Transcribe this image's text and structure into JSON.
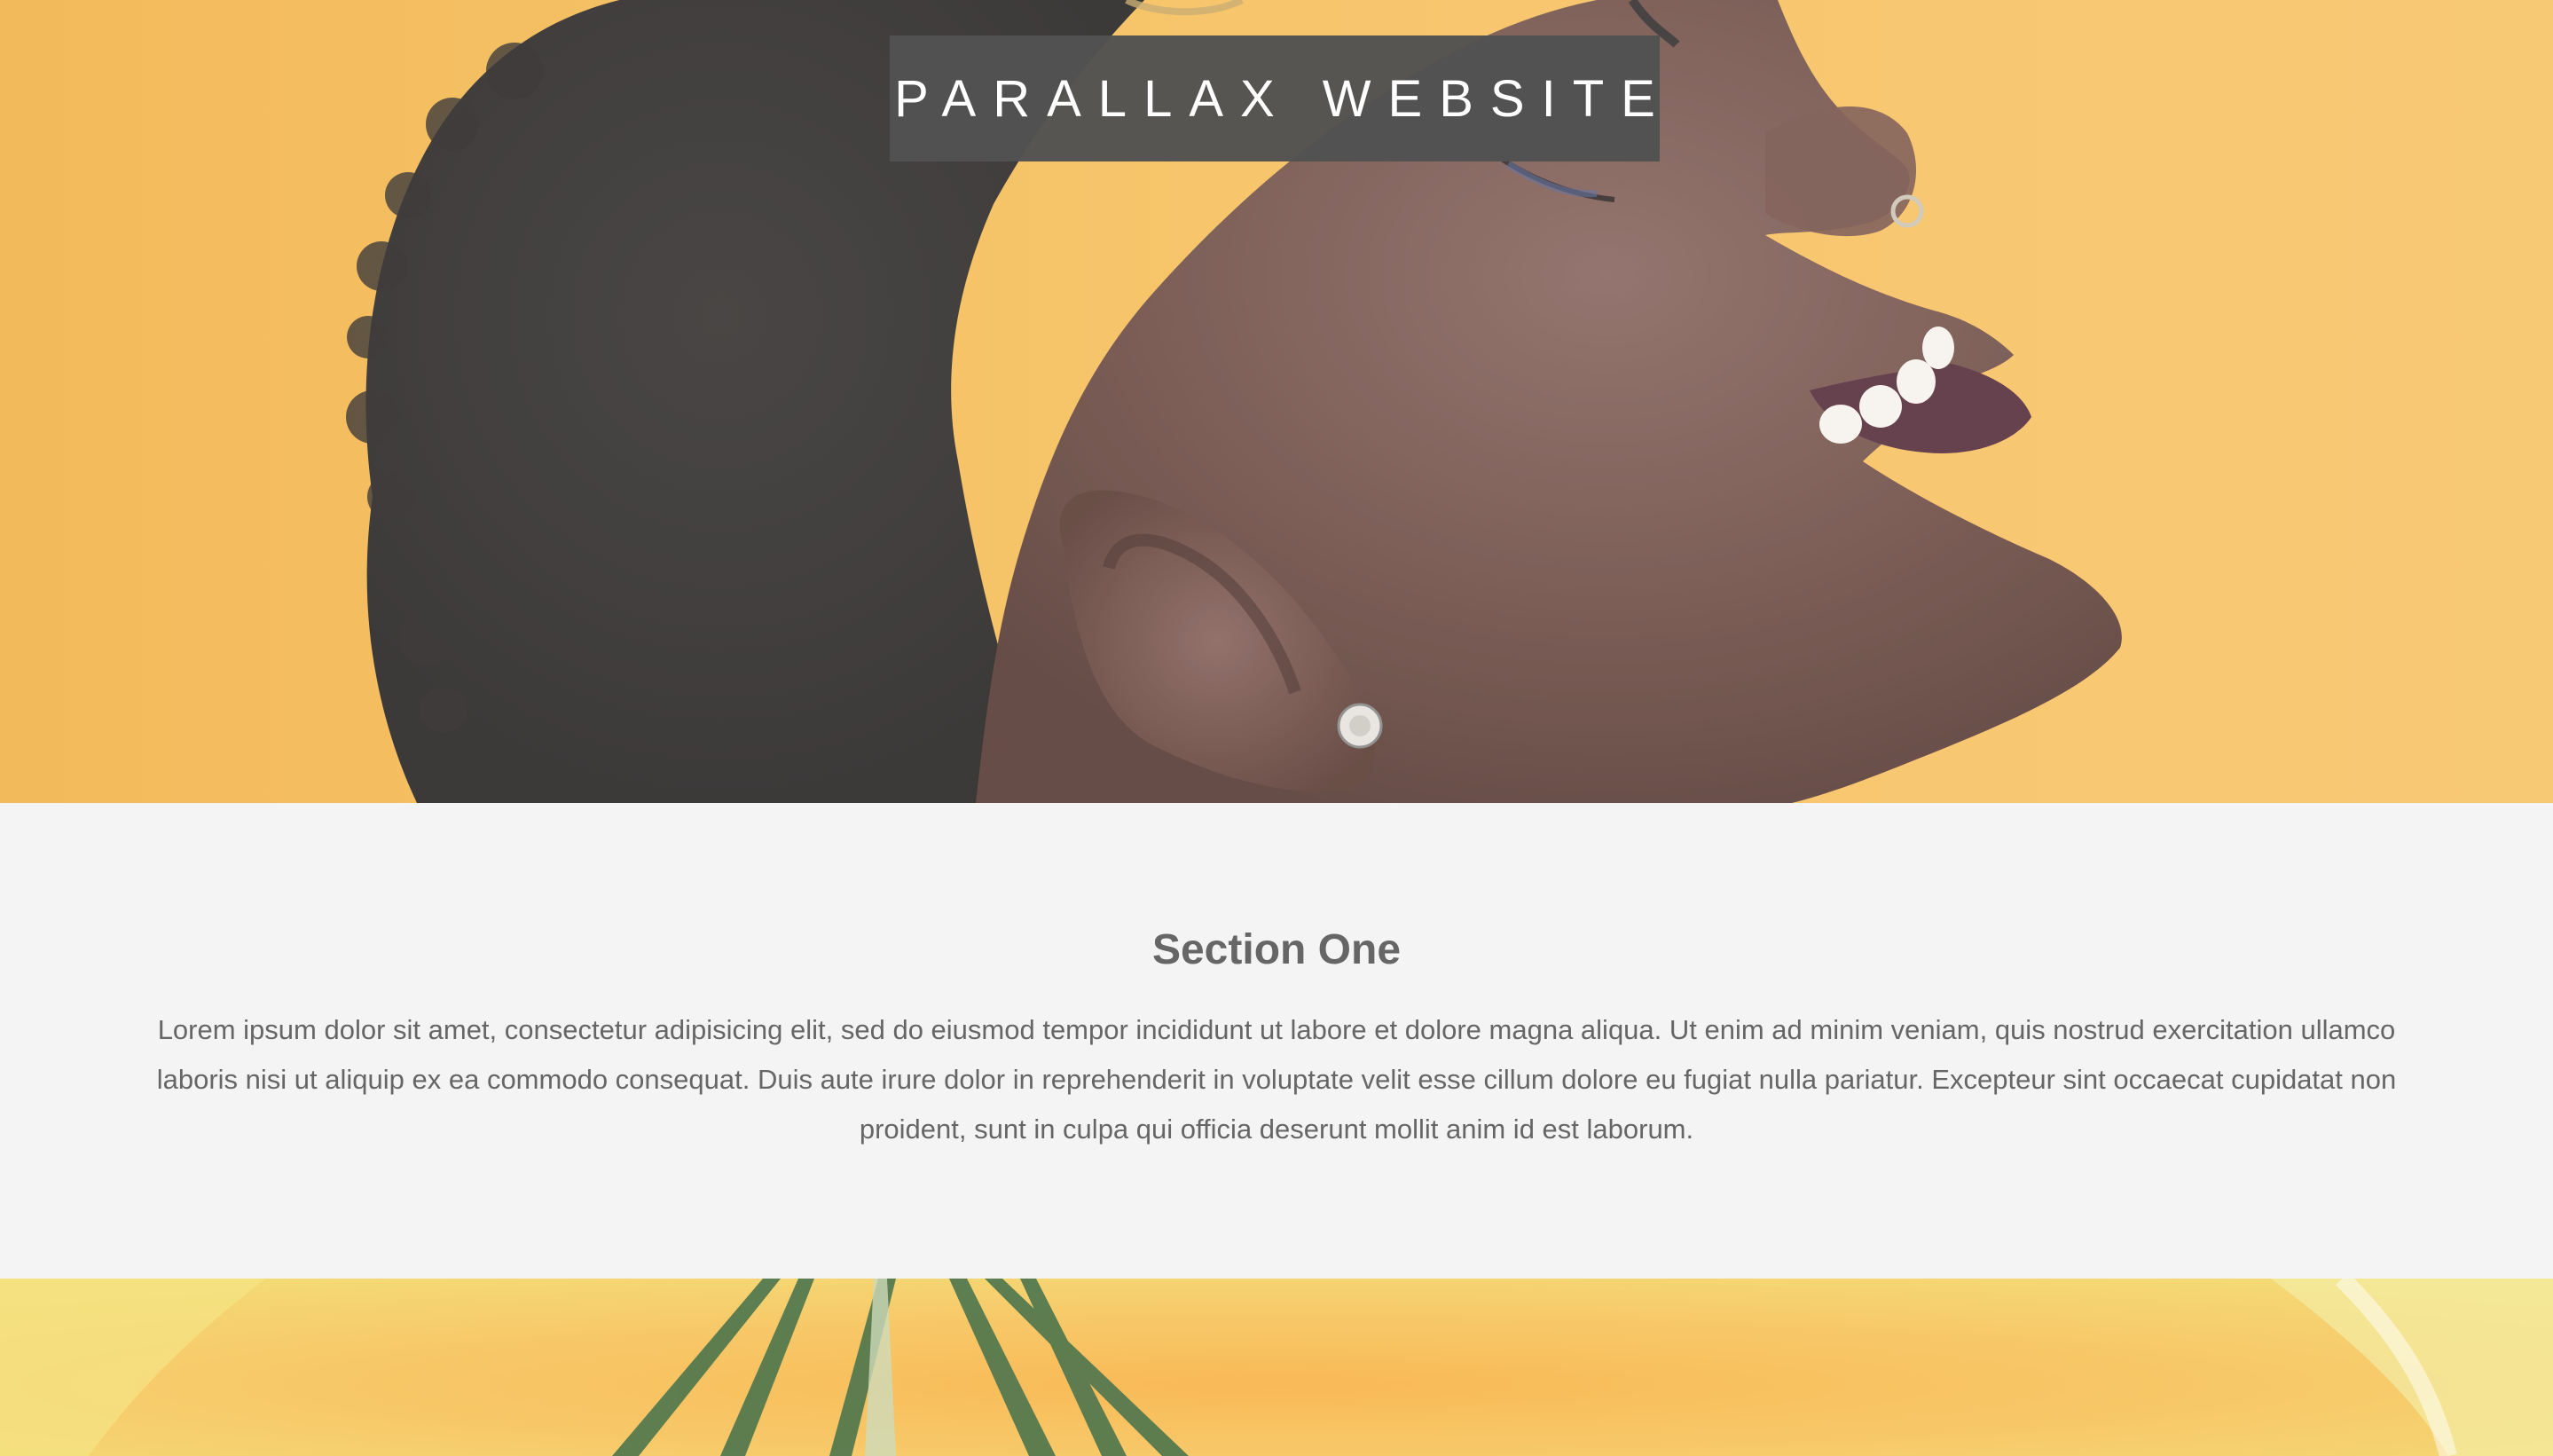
{
  "header": {
    "title": "PARALLAX WEBSITE"
  },
  "section_one": {
    "heading": "Section One",
    "body": "Lorem ipsum dolor sit amet, consectetur adipisicing elit, sed do eiusmod tempor incididunt ut labore et dolore magna aliqua. Ut enim ad minim veniam, quis nostrud exercitation ullamco laboris nisi ut aliquip ex ea commodo consequat. Duis aute irure dolor in reprehenderit in voluptate velit esse cillum dolore eu fugiat nulla pariatur. Excepteur sint occaecat cupidatat non proident, sunt in culpa qui officia deserunt mollit anim id est laborum."
  },
  "colors": {
    "hero_background": "#f6bf5b",
    "title_box": "#525252",
    "section_background": "#f4f4f4",
    "text": "#666666"
  }
}
